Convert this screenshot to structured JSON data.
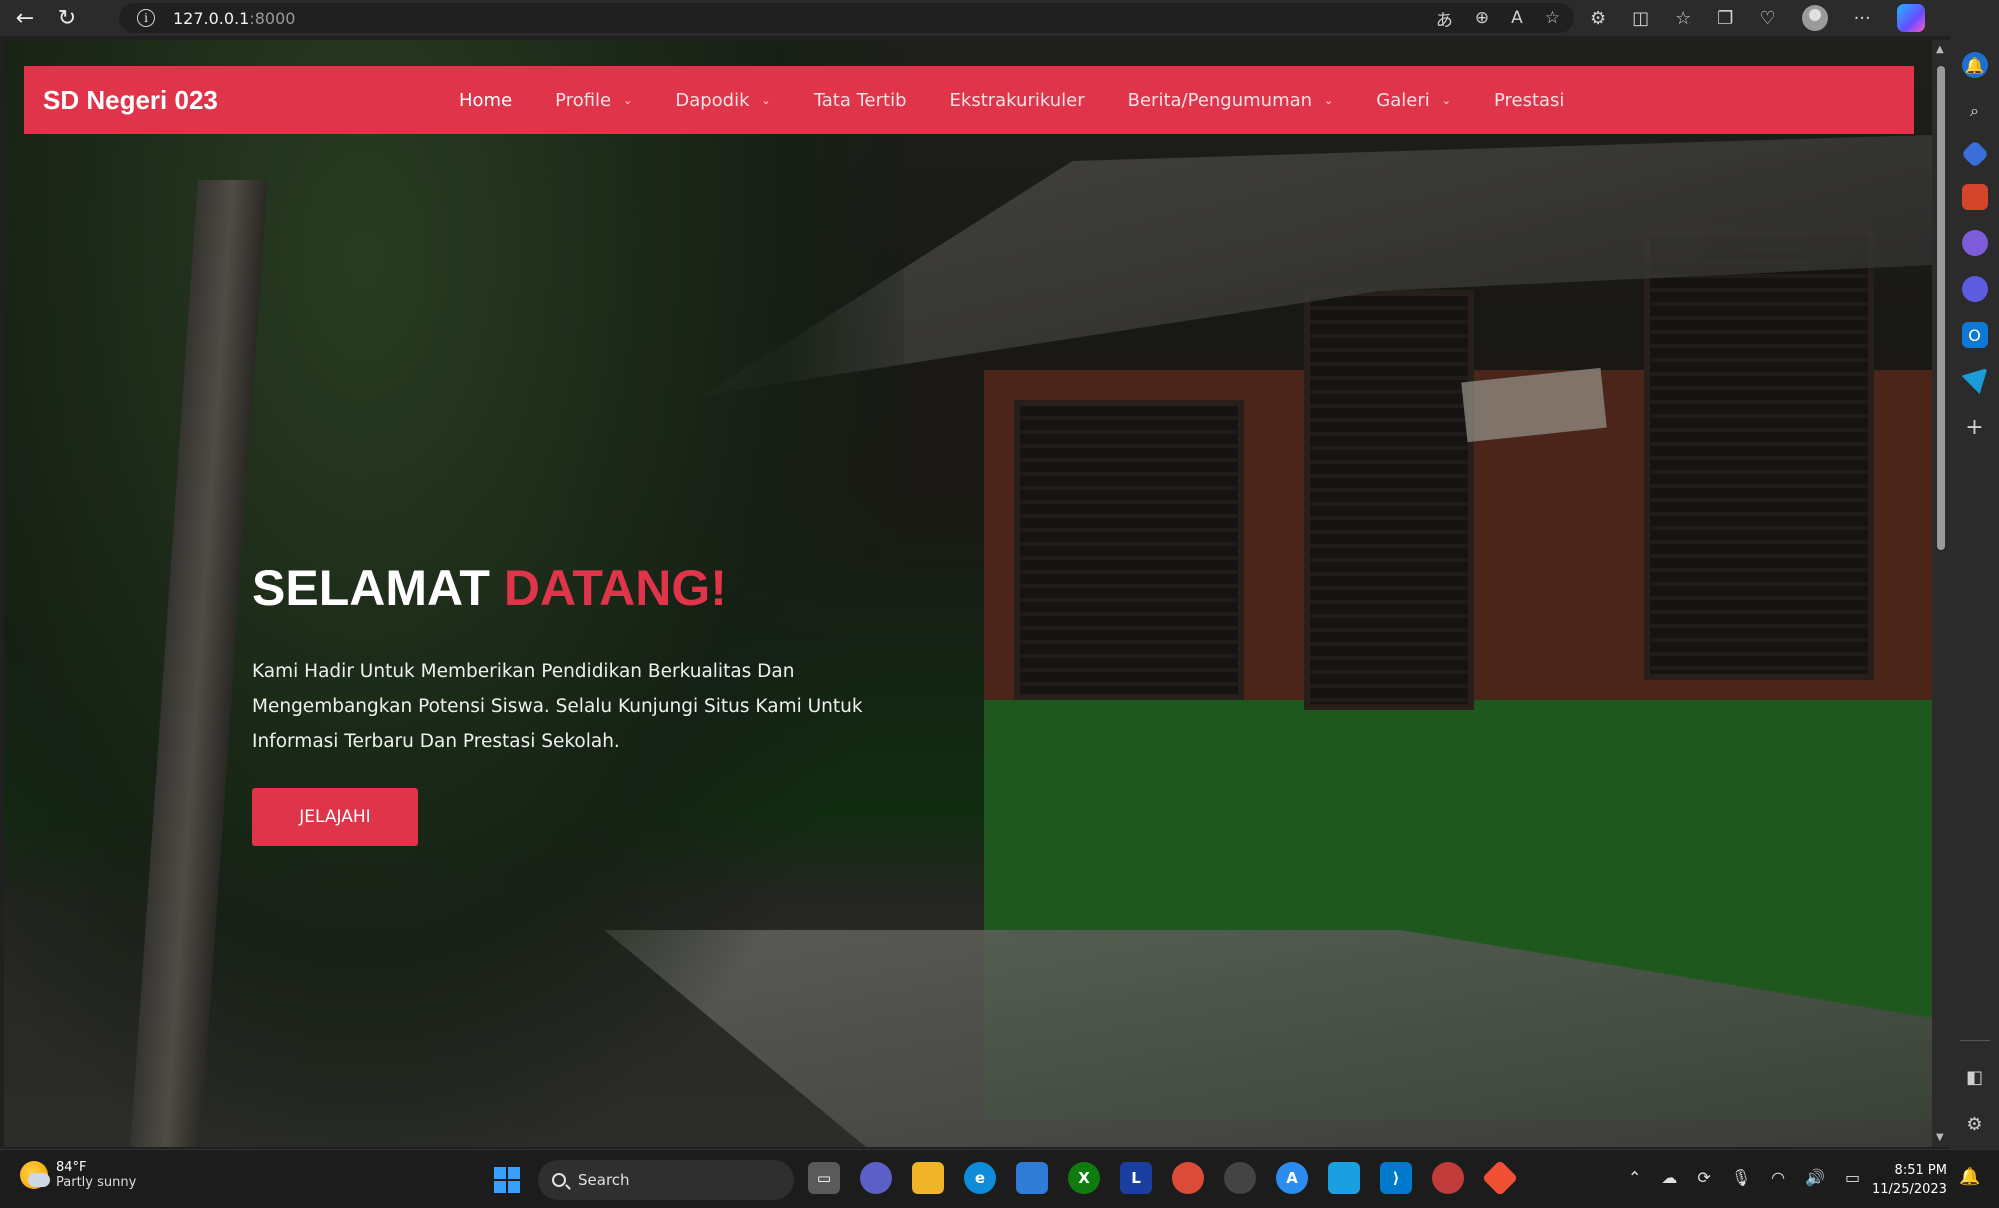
{
  "browser": {
    "url_host": "127.0.0.1",
    "url_port": ":8000"
  },
  "site": {
    "brand": "SD Negeri 023",
    "nav": [
      {
        "label": "Home",
        "dropdown": false,
        "active": true
      },
      {
        "label": "Profile",
        "dropdown": true,
        "active": false
      },
      {
        "label": "Dapodik",
        "dropdown": true,
        "active": false
      },
      {
        "label": "Tata Tertib",
        "dropdown": false,
        "active": false
      },
      {
        "label": "Ekstrakurikuler",
        "dropdown": false,
        "active": false
      },
      {
        "label": "Berita/Pengumuman",
        "dropdown": true,
        "active": false
      },
      {
        "label": "Galeri",
        "dropdown": true,
        "active": false
      },
      {
        "label": "Prestasi",
        "dropdown": false,
        "active": false
      }
    ],
    "hero": {
      "title_white": "SELAMAT ",
      "title_accent": "DATANG!",
      "text": "Kami Hadir Untuk Memberikan Pendidikan Berkualitas Dan Mengembangkan Potensi Siswa. Selalu Kunjungi Situs Kami Untuk Informasi Terbaru Dan Prestasi Sekolah.",
      "button": "JELAJAHI"
    },
    "colors": {
      "accent": "#e0344a"
    }
  },
  "taskbar": {
    "weather_temp": "84°F",
    "weather_desc": "Partly sunny",
    "search_label": "Search",
    "time": "8:51 PM",
    "date": "11/25/2023"
  }
}
